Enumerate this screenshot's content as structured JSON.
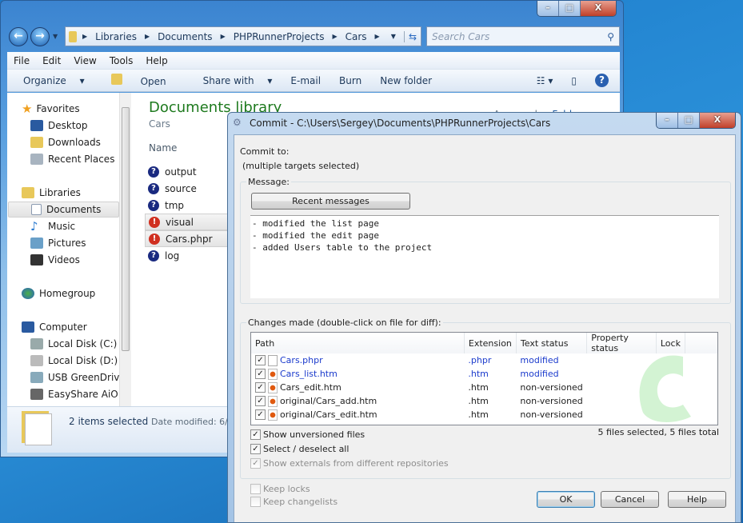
{
  "explorer": {
    "window_buttons": {
      "minimize": "–",
      "maximize": "□",
      "close": "X"
    },
    "breadcrumb": [
      "Libraries",
      "Documents",
      "PHPRunnerProjects",
      "Cars"
    ],
    "search_placeholder": "Search Cars",
    "menu": [
      "File",
      "Edit",
      "View",
      "Tools",
      "Help"
    ],
    "toolbar": {
      "organize": "Organize",
      "open": "Open",
      "share_with": "Share with",
      "email": "E-mail",
      "burn": "Burn",
      "new_folder": "New folder"
    },
    "nav": {
      "favorites": {
        "label": "Favorites",
        "items": [
          "Desktop",
          "Downloads",
          "Recent Places"
        ]
      },
      "libraries": {
        "label": "Libraries",
        "items": [
          "Documents",
          "Music",
          "Pictures",
          "Videos"
        ],
        "selected": "Documents"
      },
      "homegroup": "Homegroup",
      "computer": {
        "label": "Computer",
        "items": [
          "Local Disk (C:)",
          "Local Disk (D:)",
          "USB GreenDrive (",
          "EasyShare AiO"
        ]
      }
    },
    "library_title": "Documents library",
    "library_subtitle": "Cars",
    "arrange_by": "Arrange by:",
    "arrange_value": "Folder",
    "column_name": "Name",
    "files": [
      {
        "name": "output",
        "status": "unversioned"
      },
      {
        "name": "source",
        "status": "unversioned"
      },
      {
        "name": "tmp",
        "status": "unversioned"
      },
      {
        "name": "visual",
        "status": "modified"
      },
      {
        "name": "Cars.phpr",
        "status": "modified"
      },
      {
        "name": "log",
        "status": "unversioned"
      }
    ],
    "status": {
      "selected": "2 items selected",
      "date_modified": "Date modified: 6/"
    }
  },
  "dialog": {
    "title": "Commit - C:\\Users\\Sergey\\Documents\\PHPRunnerProjects\\Cars",
    "commit_to_label": "Commit to:",
    "commit_to_value": "(multiple targets selected)",
    "message_label": "Message:",
    "recent_messages": "Recent messages",
    "message": "- modified the list page\n- modified the edit page\n- added Users table to the project",
    "changes_label": "Changes made (double-click on file for diff):",
    "columns": [
      "Path",
      "Extension",
      "Text status",
      "Property status",
      "Lock"
    ],
    "rows": [
      {
        "path": "Cars.phpr",
        "ext": ".phpr",
        "status": "modified",
        "checked": true,
        "icon": "file"
      },
      {
        "path": "Cars_list.htm",
        "ext": ".htm",
        "status": "modified",
        "checked": true,
        "icon": "firefox"
      },
      {
        "path": "Cars_edit.htm",
        "ext": ".htm",
        "status": "non-versioned",
        "checked": true,
        "icon": "firefox"
      },
      {
        "path": "original/Cars_add.htm",
        "ext": ".htm",
        "status": "non-versioned",
        "checked": true,
        "icon": "firefox"
      },
      {
        "path": "original/Cars_edit.htm",
        "ext": ".htm",
        "status": "non-versioned",
        "checked": true,
        "icon": "firefox"
      }
    ],
    "summary": "5 files selected, 5 files total",
    "options": {
      "show_unversioned": "Show unversioned files",
      "select_all": "Select / deselect all",
      "show_externals": "Show externals from different repositories",
      "keep_locks": "Keep locks",
      "keep_changelists": "Keep changelists"
    },
    "buttons": {
      "ok": "OK",
      "cancel": "Cancel",
      "help": "Help"
    },
    "colors": {
      "modified": "#1a3acc",
      "accent_green": "#1f9a3a"
    }
  }
}
